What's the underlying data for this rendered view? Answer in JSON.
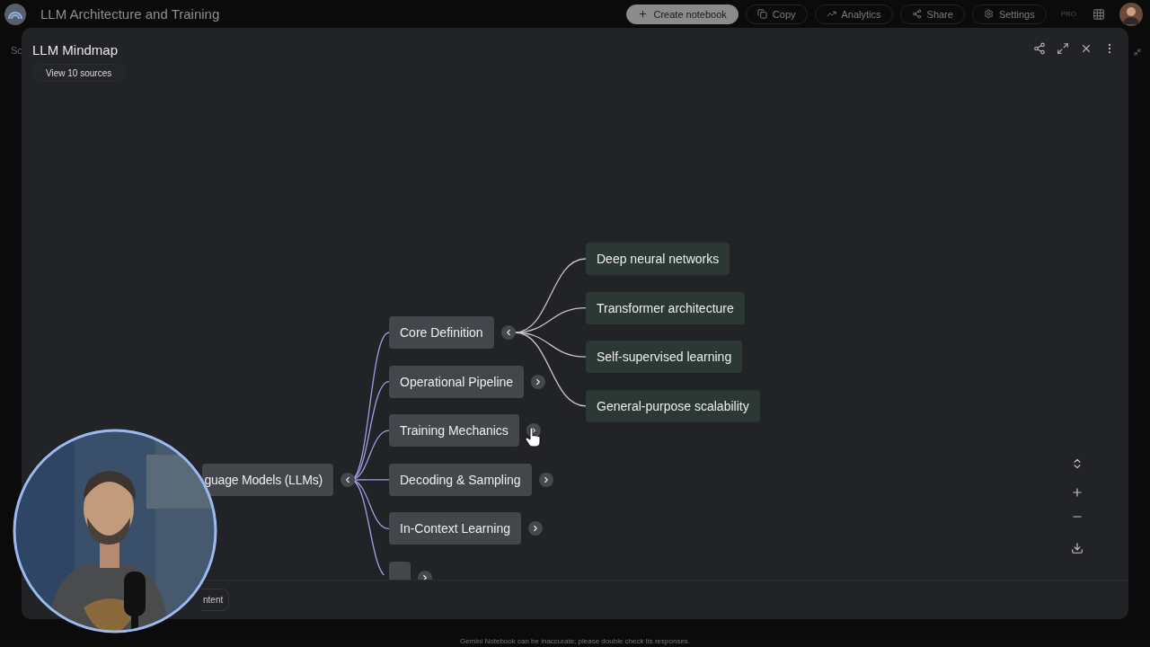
{
  "app_bar": {
    "title": "LLM Architecture and Training",
    "buttons": [
      {
        "label": "Create notebook",
        "kind": "primary"
      },
      {
        "label": "Copy",
        "kind": "copy"
      },
      {
        "label": "Analytics",
        "kind": "analytics"
      },
      {
        "label": "Share",
        "kind": "share"
      },
      {
        "label": "Settings",
        "kind": "settings"
      }
    ],
    "badge": "PRO"
  },
  "sidebar": {
    "label": "Sc"
  },
  "mindmap_panel": {
    "title": "LLM Mindmap",
    "sources_button": "View 10 sources",
    "root": {
      "label": "guage Models (LLMs)",
      "expanded": true,
      "children": [
        {
          "label": "Core Definition",
          "expanded": true,
          "children": [
            {
              "label": "Deep neural networks"
            },
            {
              "label": "Transformer architecture"
            },
            {
              "label": "Self-supervised learning"
            },
            {
              "label": "General-purpose scalability"
            }
          ]
        },
        {
          "label": "Operational Pipeline",
          "expanded": false
        },
        {
          "label": "Training Mechanics",
          "expanded": false
        },
        {
          "label": "Decoding & Sampling",
          "expanded": false
        },
        {
          "label": "In-Context Learning",
          "expanded": false
        },
        {
          "expanded": false
        }
      ]
    },
    "bottom_button": "ntent"
  },
  "footer": "Gemini Notebook can be inaccurate; please double check its responses."
}
